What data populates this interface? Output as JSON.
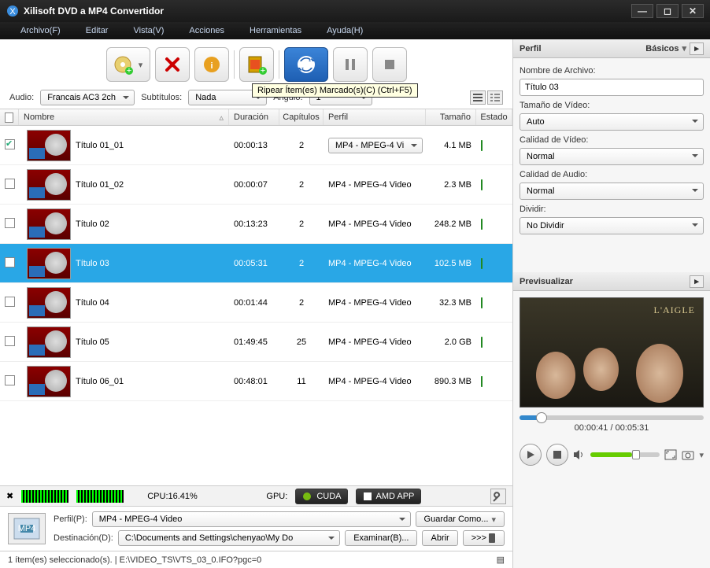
{
  "app": {
    "title": "Xilisoft DVD a MP4 Convertidor"
  },
  "menu": [
    "Archivo(F)",
    "Editar",
    "Vista(V)",
    "Acciones",
    "Herramientas",
    "Ayuda(H)"
  ],
  "tooltip": "Ripear Ítem(es) Marcado(s)(C) (Ctrl+F5)",
  "opts": {
    "audio_label": "Audio:",
    "audio_value": "Francais AC3 2ch",
    "sub_label": "Subtítulos:",
    "sub_value": "Nada",
    "angle_label": "Ángulo:",
    "angle_value": "1"
  },
  "columns": {
    "nombre": "Nombre",
    "duracion": "Duración",
    "capitulos": "Capítulos",
    "perfil": "Perfil",
    "tamano": "Tamaño",
    "estado": "Estado"
  },
  "rows": [
    {
      "checked": true,
      "name": "Título 01_01",
      "dur": "00:00:13",
      "cap": "2",
      "perfil": "MP4 - MPEG-4 Vi",
      "perfil_dropdown": true,
      "size": "4.1 MB",
      "selected": false
    },
    {
      "checked": false,
      "name": "Título 01_02",
      "dur": "00:00:07",
      "cap": "2",
      "perfil": "MP4 - MPEG-4 Video",
      "perfil_dropdown": false,
      "size": "2.3 MB",
      "selected": false
    },
    {
      "checked": false,
      "name": "Título 02",
      "dur": "00:13:23",
      "cap": "2",
      "perfil": "MP4 - MPEG-4 Video",
      "perfil_dropdown": false,
      "size": "248.2 MB",
      "selected": false
    },
    {
      "checked": false,
      "name": "Título 03",
      "dur": "00:05:31",
      "cap": "2",
      "perfil": "MP4 - MPEG-4 Video",
      "perfil_dropdown": false,
      "size": "102.5 MB",
      "selected": true
    },
    {
      "checked": false,
      "name": "Título 04",
      "dur": "00:01:44",
      "cap": "2",
      "perfil": "MP4 - MPEG-4 Video",
      "perfil_dropdown": false,
      "size": "32.3 MB",
      "selected": false
    },
    {
      "checked": false,
      "name": "Título 05",
      "dur": "01:49:45",
      "cap": "25",
      "perfil": "MP4 - MPEG-4 Video",
      "perfil_dropdown": false,
      "size": "2.0 GB",
      "selected": false
    },
    {
      "checked": false,
      "name": "Título 06_01",
      "dur": "00:48:01",
      "cap": "11",
      "perfil": "MP4 - MPEG-4 Video",
      "perfil_dropdown": false,
      "size": "890.3 MB",
      "selected": false
    }
  ],
  "gpu": {
    "cpu": "CPU:16.41%",
    "gpu_label": "GPU:",
    "cuda": "CUDA",
    "amd": "AMD APP"
  },
  "bottom": {
    "perfil_label": "Perfil(P):",
    "perfil_value": "MP4 - MPEG-4 Video",
    "guardar": "Guardar Como...",
    "dest_label": "Destinación(D):",
    "dest_value": "C:\\Documents and Settings\\chenyao\\My Do",
    "examinar": "Examinar(B)...",
    "abrir": "Abrir",
    "device": ">>>"
  },
  "status": "1 ítem(es) seleccionado(s). | E:\\VIDEO_TS\\VTS_03_0.IFO?pgc=0",
  "right": {
    "perfil_head": "Perfil",
    "basicos": "Básicos",
    "nombre_label": "Nombre de Archivo:",
    "nombre_value": "Título 03",
    "tamano_label": "Tamaño de Vídeo:",
    "tamano_value": "Auto",
    "calvideo_label": "Calidad de Vídeo:",
    "calvideo_value": "Normal",
    "calaudio_label": "Calidad de Audio:",
    "calaudio_value": "Normal",
    "dividir_label": "Dividir:",
    "dividir_value": "No Dividir",
    "preview_head": "Previsualizar",
    "time": "00:00:41 / 00:05:31",
    "progress_pct": 12
  }
}
